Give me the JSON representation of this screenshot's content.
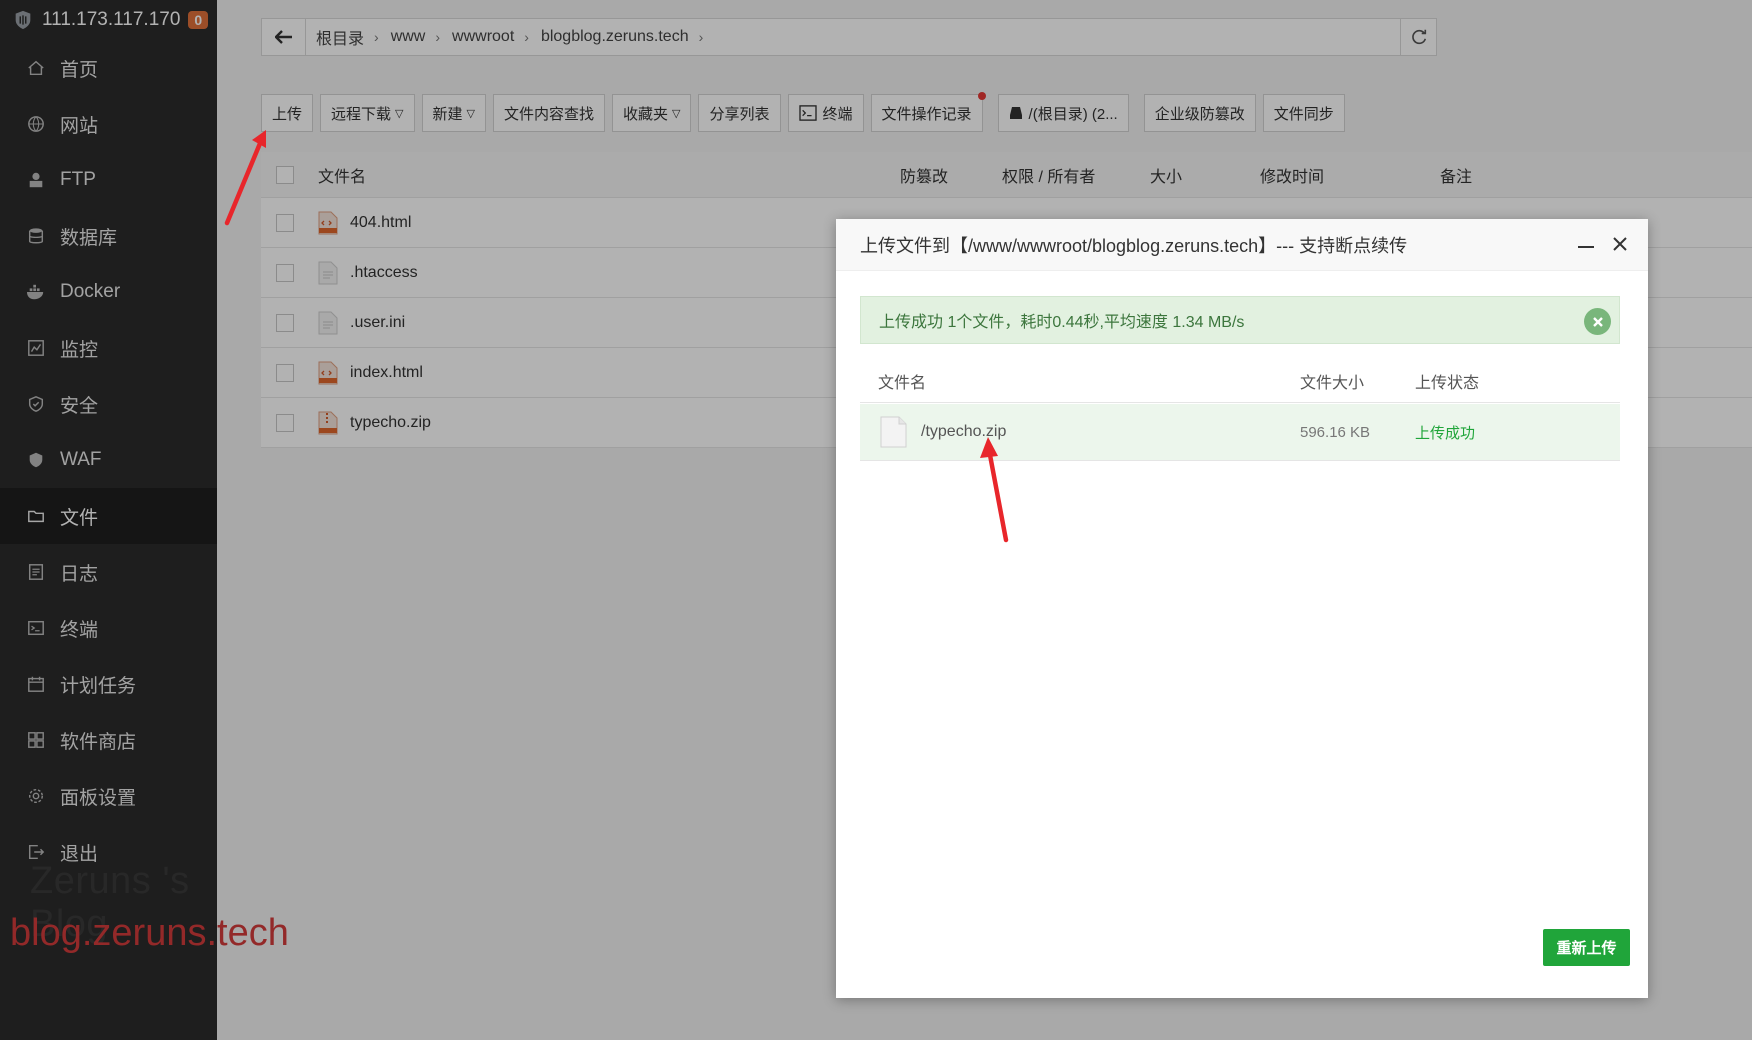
{
  "sidebar": {
    "host": "111.173.117.170",
    "badge": "0",
    "items": [
      {
        "label": "首页",
        "icon": "home-icon"
      },
      {
        "label": "网站",
        "icon": "globe-icon"
      },
      {
        "label": "FTP",
        "icon": "ftp-icon"
      },
      {
        "label": "数据库",
        "icon": "database-icon"
      },
      {
        "label": "Docker",
        "icon": "docker-icon"
      },
      {
        "label": "监控",
        "icon": "monitor-icon"
      },
      {
        "label": "安全",
        "icon": "shield-icon"
      },
      {
        "label": "WAF",
        "icon": "waf-icon"
      },
      {
        "label": "文件",
        "icon": "folder-icon"
      },
      {
        "label": "日志",
        "icon": "log-icon"
      },
      {
        "label": "终端",
        "icon": "terminal-icon"
      },
      {
        "label": "计划任务",
        "icon": "calendar-icon"
      },
      {
        "label": "软件商店",
        "icon": "apps-icon"
      },
      {
        "label": "面板设置",
        "icon": "gear-icon"
      },
      {
        "label": "退出",
        "icon": "logout-icon"
      }
    ],
    "active_index": 8
  },
  "watermark": {
    "line1": "Zeruns 's Blog",
    "line2": "blog.zeruns.tech"
  },
  "breadcrumb": [
    "根目录",
    "www",
    "wwwroot",
    "blogblog.zeruns.tech"
  ],
  "toolbar": {
    "upload": "上传",
    "remote_download": "远程下载",
    "new": "新建",
    "content_search": "文件内容查找",
    "favorites": "收藏夹",
    "share_list": "分享列表",
    "terminal": "终端",
    "op_log": "文件操作记录",
    "disk": "/(根目录) (2...",
    "tamper_proof": "企业级防篡改",
    "file_sync": "文件同步"
  },
  "table": {
    "headers": [
      "文件名",
      "防篡改",
      "权限 / 所有者",
      "大小",
      "修改时间",
      "备注"
    ],
    "files": [
      {
        "name": "404.html",
        "type": "html"
      },
      {
        "name": ".htaccess",
        "type": "text"
      },
      {
        "name": ".user.ini",
        "type": "text"
      },
      {
        "name": "index.html",
        "type": "html"
      },
      {
        "name": "typecho.zip",
        "type": "zip"
      }
    ]
  },
  "modal": {
    "title": "上传文件到【/www/wwwroot/blogblog.zeruns.tech】--- 支持断点续传",
    "success_msg": "上传成功 1个文件，耗时0.44秒,平均速度 1.34 MB/s",
    "headers": [
      "文件名",
      "文件大小",
      "上传状态"
    ],
    "file": {
      "name": "/typecho.zip",
      "size": "596.16 KB",
      "status": "上传成功"
    },
    "reupload": "重新上传"
  },
  "colors": {
    "sidebar_bg": "#2b2b2b",
    "accent_green": "#20a53a",
    "success_bg": "#e2f1e0",
    "arrow_red": "#e8262b"
  }
}
